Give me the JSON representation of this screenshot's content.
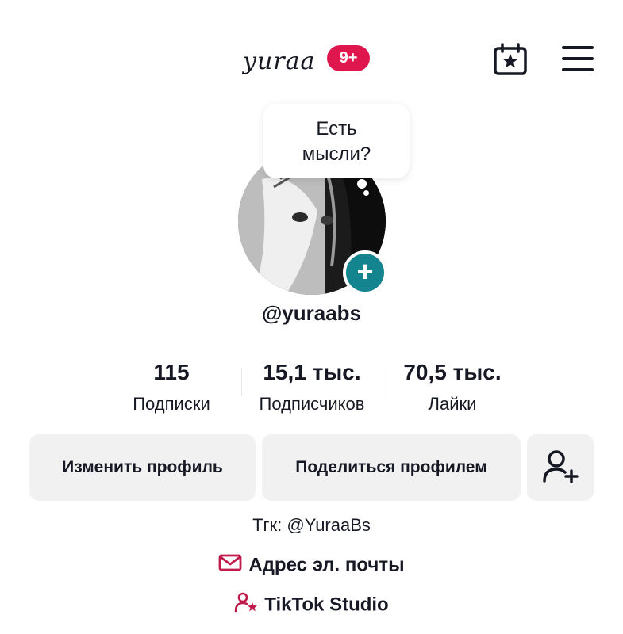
{
  "header": {
    "logo_text": "yuraa",
    "notification_badge": "9+",
    "accent_color": "#e0174f"
  },
  "bubble": {
    "line1": "Есть",
    "line2": "мысли?"
  },
  "profile": {
    "username": "@yuraabs",
    "add_button_color": "#14858f"
  },
  "stats": [
    {
      "value": "115",
      "label": "Подписки"
    },
    {
      "value": "15,1 тыс.",
      "label": "Подписчиков"
    },
    {
      "value": "70,5 тыс.",
      "label": "Лайки"
    }
  ],
  "buttons": {
    "edit_profile": "Изменить профиль",
    "share_profile": "Поделиться профилем",
    "add_friend_icon": "person-add-icon"
  },
  "bio": {
    "text": "Тгк: @YuraaBs",
    "email_label": "Адрес эл. почты",
    "studio_label": "TikTok Studio",
    "link_icon_color": "#c11a4b"
  }
}
